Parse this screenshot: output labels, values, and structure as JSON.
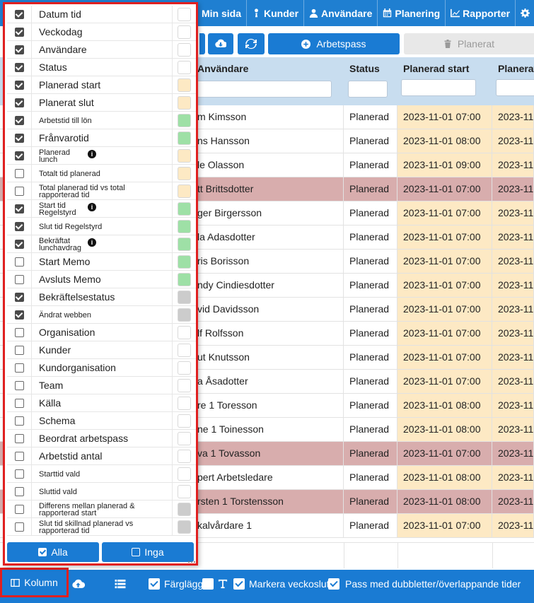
{
  "nav": {
    "items": [
      {
        "label": "Min sida",
        "icon": "home-icon"
      },
      {
        "label": "Kunder",
        "icon": "person-tie-icon"
      },
      {
        "label": "Användare",
        "icon": "user-icon"
      },
      {
        "label": "Planering",
        "icon": "calendar-icon"
      },
      {
        "label": "Rapporter",
        "icon": "chart-line-icon"
      },
      {
        "label": "",
        "icon": "gear-icon"
      }
    ]
  },
  "toolbar": {
    "arbetspass_label": "Arbetspass",
    "planerat_label": "Planerat"
  },
  "grid": {
    "headers": {
      "name": "Användare",
      "status": "Status",
      "start": "Planerad start",
      "end": "Planerat"
    },
    "rows": [
      {
        "name": "m Kimsson",
        "status": "Planerad",
        "start": "2023-11-01 07:00",
        "end": "2023-11",
        "red": false
      },
      {
        "name": "ns Hansson",
        "status": "Planerad",
        "start": "2023-11-01 08:00",
        "end": "2023-11",
        "red": false
      },
      {
        "name": "le Olasson",
        "status": "Planerad",
        "start": "2023-11-01 09:00",
        "end": "2023-11",
        "red": false
      },
      {
        "name": "tt Brittsdotter",
        "status": "Planerad",
        "start": "2023-11-01 07:00",
        "end": "2023-11",
        "red": true
      },
      {
        "name": "ger Birgersson",
        "status": "Planerad",
        "start": "2023-11-01 07:00",
        "end": "2023-11",
        "red": false
      },
      {
        "name": "la Adasdotter",
        "status": "Planerad",
        "start": "2023-11-01 07:00",
        "end": "2023-11",
        "red": false
      },
      {
        "name": "ris Borisson",
        "status": "Planerad",
        "start": "2023-11-01 07:00",
        "end": "2023-11",
        "red": false
      },
      {
        "name": "ndy Cindiesdotter",
        "status": "Planerad",
        "start": "2023-11-01 07:00",
        "end": "2023-11",
        "red": false
      },
      {
        "name": "vid Davidsson",
        "status": "Planerad",
        "start": "2023-11-01 07:00",
        "end": "2023-11",
        "red": false
      },
      {
        "name": "lf Rolfsson",
        "status": "Planerad",
        "start": "2023-11-01 07:00",
        "end": "2023-11",
        "red": false
      },
      {
        "name": "ut Knutsson",
        "status": "Planerad",
        "start": "2023-11-01 07:00",
        "end": "2023-11",
        "red": false
      },
      {
        "name": "a Åsadotter",
        "status": "Planerad",
        "start": "2023-11-01 07:00",
        "end": "2023-11",
        "red": false
      },
      {
        "name": "re 1 Toresson",
        "status": "Planerad",
        "start": "2023-11-01 08:00",
        "end": "2023-11",
        "red": false
      },
      {
        "name": "ne 1 Toinesson",
        "status": "Planerad",
        "start": "2023-11-01 08:00",
        "end": "2023-11",
        "red": false
      },
      {
        "name": "va 1 Tovasson",
        "status": "Planerad",
        "start": "2023-11-01 07:00",
        "end": "2023-11",
        "red": true
      },
      {
        "name": "pert Arbetsledare",
        "status": "Planerad",
        "start": "2023-11-01 08:00",
        "end": "2023-11",
        "red": false
      },
      {
        "name": "rsten 1 Torstensson",
        "status": "Planerad",
        "start": "2023-11-01 08:00",
        "end": "2023-11",
        "red": true
      },
      {
        "name": "kalvårdare 1",
        "status": "Planerad",
        "start": "2023-11-01 07:00",
        "end": "2023-11",
        "red": false
      }
    ]
  },
  "panel": {
    "items": [
      {
        "label": "Datum tid",
        "checked": true,
        "small": false,
        "info": false,
        "color": "#ffffff"
      },
      {
        "label": "Veckodag",
        "checked": true,
        "small": false,
        "info": false,
        "color": "#ffffff"
      },
      {
        "label": "Användare",
        "checked": true,
        "small": false,
        "info": false,
        "color": "#ffffff"
      },
      {
        "label": "Status",
        "checked": true,
        "small": false,
        "info": false,
        "color": "#ffffff"
      },
      {
        "label": "Planerad start",
        "checked": true,
        "small": false,
        "info": false,
        "color": "#fde9c4"
      },
      {
        "label": "Planerat slut",
        "checked": true,
        "small": false,
        "info": false,
        "color": "#fde9c4"
      },
      {
        "label": "Arbetstid till lön",
        "checked": true,
        "small": true,
        "info": false,
        "color": "#9ee0a6"
      },
      {
        "label": "Frånvarotid",
        "checked": true,
        "small": false,
        "info": false,
        "color": "#9ee0a6"
      },
      {
        "label": "Planerad lunch",
        "checked": true,
        "small": true,
        "info": true,
        "color": "#fde9c4"
      },
      {
        "label": "Totalt tid planerad",
        "checked": false,
        "small": true,
        "info": false,
        "color": "#fde9c4"
      },
      {
        "label": "Total planerad tid vs total rapporterad tid",
        "checked": false,
        "small": true,
        "info": false,
        "color": "#fde9c4"
      },
      {
        "label": "Start tid Regelstyrd",
        "checked": true,
        "small": true,
        "info": true,
        "color": "#9ee0a6"
      },
      {
        "label": "Slut tid Regelstyrd",
        "checked": true,
        "small": true,
        "info": false,
        "color": "#9ee0a6"
      },
      {
        "label": "Bekräftat lunchavdrag",
        "checked": true,
        "small": true,
        "info": true,
        "color": "#9ee0a6"
      },
      {
        "label": "Start Memo",
        "checked": false,
        "small": false,
        "info": false,
        "color": "#9ee0a6"
      },
      {
        "label": "Avsluts Memo",
        "checked": false,
        "small": false,
        "info": false,
        "color": "#9ee0a6"
      },
      {
        "label": "Bekräftelsestatus",
        "checked": true,
        "small": false,
        "info": false,
        "color": "#cccccc"
      },
      {
        "label": "Ändrat webben",
        "checked": true,
        "small": true,
        "info": false,
        "color": "#cccccc"
      },
      {
        "label": "Organisation",
        "checked": false,
        "small": false,
        "info": false,
        "color": "#ffffff"
      },
      {
        "label": "Kunder",
        "checked": false,
        "small": false,
        "info": false,
        "color": "#ffffff"
      },
      {
        "label": "Kundorganisation",
        "checked": false,
        "small": false,
        "info": false,
        "color": "#ffffff"
      },
      {
        "label": "Team",
        "checked": false,
        "small": false,
        "info": false,
        "color": "#ffffff"
      },
      {
        "label": "Källa",
        "checked": false,
        "small": false,
        "info": false,
        "color": "#ffffff"
      },
      {
        "label": "Schema",
        "checked": false,
        "small": false,
        "info": false,
        "color": "#ffffff"
      },
      {
        "label": "Beordrat arbetspass",
        "checked": false,
        "small": false,
        "info": false,
        "color": "#ffffff"
      },
      {
        "label": "Arbetstid antal",
        "checked": false,
        "small": false,
        "info": false,
        "color": "#ffffff"
      },
      {
        "label": "Starttid vald",
        "checked": false,
        "small": true,
        "info": false,
        "color": "#ffffff"
      },
      {
        "label": "Sluttid vald",
        "checked": false,
        "small": true,
        "info": false,
        "color": "#ffffff"
      },
      {
        "label": "Differens mellan planerad & rapporterad start",
        "checked": false,
        "small": true,
        "info": false,
        "color": "#cccccc"
      },
      {
        "label": "Slut tid skillnad planerad vs rapporterad tid",
        "checked": false,
        "small": true,
        "info": false,
        "color": "#cccccc"
      }
    ],
    "all_label": "Alla",
    "none_label": "Inga"
  },
  "bottom": {
    "kolumn_label": "Kolumn",
    "farglagg_label": "Färglägg",
    "markera_label": "Markera veckoslut",
    "pass_label": "Pass med dubbletter/överlappande tider"
  }
}
